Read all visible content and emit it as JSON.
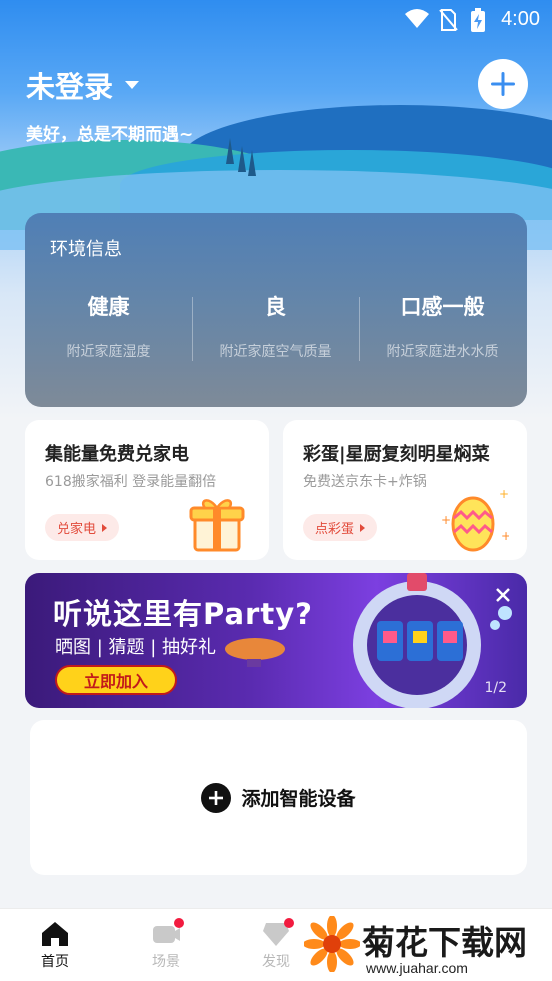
{
  "status_bar": {
    "time": "4:00",
    "icons": [
      "wifi-icon",
      "no-sim-icon",
      "battery-charging-icon"
    ]
  },
  "header": {
    "title": "未登录",
    "subtitle": "美好，总是不期而遇~",
    "add_icon": "plus-icon"
  },
  "environment": {
    "title": "环境信息",
    "items": [
      {
        "value": "健康",
        "label": "附近家庭湿度"
      },
      {
        "value": "良",
        "label": "附近家庭空气质量"
      },
      {
        "value": "口感一般",
        "label": "附近家庭进水水质"
      }
    ]
  },
  "promos": [
    {
      "title": "集能量免费兑家电",
      "subtitle": "618搬家福利  登录能量翻倍",
      "button": "兑家电",
      "icon": "gift-box-icon"
    },
    {
      "title": "彩蛋|星厨复刻明星焖菜",
      "subtitle": "免费送京东卡+炸锅",
      "button": "点彩蛋",
      "icon": "easter-egg-icon"
    }
  ],
  "banner": {
    "title": "听说这里有Party?",
    "subtitle": "晒图 | 猜题 | 抽好礼",
    "button": "立即加入",
    "page_indicator": "1/2"
  },
  "device": {
    "add_label": "添加智能设备"
  },
  "tabs": [
    {
      "label": "首页",
      "icon": "home-icon",
      "active": true,
      "badge": false
    },
    {
      "label": "场景",
      "icon": "scene-icon",
      "active": false,
      "badge": true
    },
    {
      "label": "发现",
      "icon": "discover-icon",
      "active": false,
      "badge": true
    }
  ],
  "watermark": {
    "name": "菊花下载网",
    "url": "www.juahar.com"
  },
  "colors": {
    "accent_red": "#e24b3b",
    "badge_red": "#f21b3f",
    "banner_button": "#ffd21a"
  }
}
